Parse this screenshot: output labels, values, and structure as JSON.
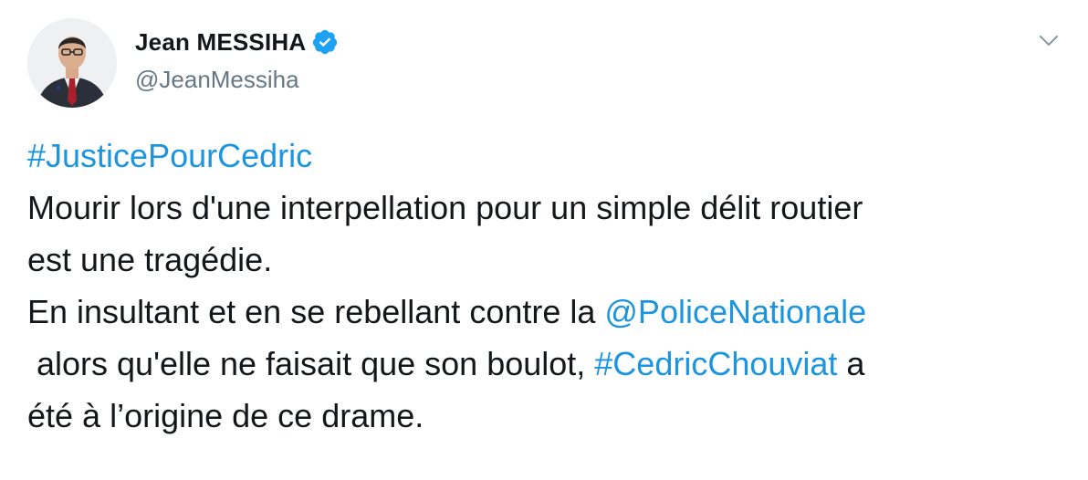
{
  "author": {
    "display_name": "Jean MESSIHA",
    "handle": "@JeanMessiha",
    "verified": true
  },
  "tweet": {
    "hashtag_top": "#JusticePourCedric",
    "line1": "Mourir lors d'une interpellation pour un simple délit routier",
    "line2": "est une tragédie.",
    "line3_text": "En insultant et en se rebellant contre la ",
    "mention": "@PoliceNationale",
    "line4_text": " alors qu'elle ne faisait que son boulot, ",
    "hashtag_inline": "#CedricChouviat",
    "line4_end": " a",
    "line5": "été à l’origine de ce drame."
  },
  "colors": {
    "link": "#1b95e0",
    "verified_badge": "#1da1f2",
    "handle": "#657786",
    "text": "#14171a"
  },
  "icons": {
    "avatar": "profile-photo",
    "verified": "verified-badge-icon",
    "menu": "chevron-down-icon"
  }
}
